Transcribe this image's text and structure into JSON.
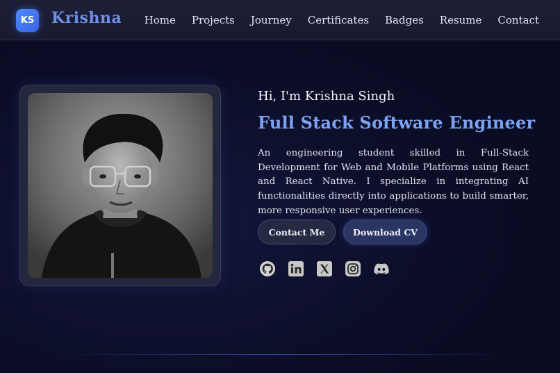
{
  "navbar": {
    "logo_initials": "KS",
    "brand": "Krishna",
    "links": [
      {
        "label": "Home"
      },
      {
        "label": "Projects"
      },
      {
        "label": "Journey"
      },
      {
        "label": "Certificates"
      },
      {
        "label": "Badges"
      },
      {
        "label": "Resume"
      },
      {
        "label": "Contact"
      }
    ]
  },
  "hero": {
    "greeting": "Hi, I'm Krishna Singh",
    "role": "Full Stack Software Engineer",
    "bio": "An engineering student skilled in Full-Stack Development for Web and Mobile Platforms using React and React Native. I specialize in integrating AI functionalities directly into applications to build smarter, more responsive user experiences.",
    "buttons": {
      "contact": "Contact Me",
      "download": "Download CV"
    }
  },
  "socials": [
    {
      "icon": "github-icon"
    },
    {
      "icon": "linkedin-icon"
    },
    {
      "icon": "x-icon"
    },
    {
      "icon": "instagram-icon"
    },
    {
      "icon": "discord-icon"
    }
  ],
  "colors": {
    "background": "#0b0d26",
    "accent": "#7da2f2",
    "logo_badge": "#4f8bff"
  }
}
